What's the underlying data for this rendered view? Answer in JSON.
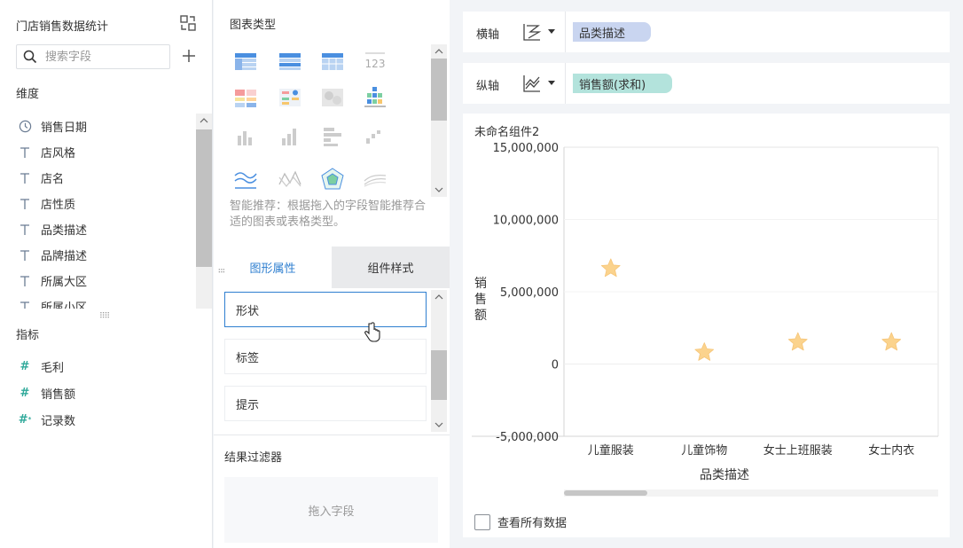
{
  "left_panel": {
    "dataset_title": "门店销售数据统计",
    "search_placeholder": "搜索字段",
    "dimension_label": "维度",
    "dimensions": [
      {
        "label": "销售日期",
        "icon": "clock-icon"
      },
      {
        "label": "店风格",
        "icon": "text-field-icon"
      },
      {
        "label": "店名",
        "icon": "text-field-icon"
      },
      {
        "label": "店性质",
        "icon": "text-field-icon"
      },
      {
        "label": "品类描述",
        "icon": "text-field-icon"
      },
      {
        "label": "品牌描述",
        "icon": "text-field-icon"
      },
      {
        "label": "所属大区",
        "icon": "text-field-icon"
      },
      {
        "label": "所属小区",
        "icon": "text-field-icon"
      }
    ],
    "measure_label": "指标",
    "measures": [
      {
        "label": "毛利",
        "icon": "hash-icon"
      },
      {
        "label": "销售额",
        "icon": "hash-icon"
      },
      {
        "label": "记录数",
        "icon": "hash-count-icon"
      }
    ]
  },
  "middle_panel": {
    "chart_type_title": "图表类型",
    "smart_tip": "智能推荐：根据拖入的字段智能推荐合适的图表或表格类型。",
    "tabs": [
      {
        "label": "图形属性",
        "active": true
      },
      {
        "label": "组件样式",
        "active": false
      }
    ],
    "properties": [
      "形状",
      "标签",
      "提示"
    ],
    "filter_title": "结果过滤器",
    "drop_placeholder": "拖入字段"
  },
  "axes": {
    "x_label": "横轴",
    "x_field": "品类描述",
    "x_field_color": "#c9d5f0",
    "y_label": "纵轴",
    "y_field": "销售额(求和)",
    "y_field_color": "#b3e3dc"
  },
  "chart_card": {
    "widget_name": "未命名组件2",
    "view_all_label": "查看所有数据"
  },
  "colors": {
    "accent": "#2f7fd0",
    "star": "#fbd38d"
  },
  "chart_data": {
    "type": "scatter",
    "marker": "star",
    "categories": [
      "儿童服装",
      "儿童饰物",
      "女士上班服装",
      "女士内衣"
    ],
    "values": [
      6600000,
      800000,
      1500000,
      1500000
    ],
    "xlabel": "品类描述",
    "ylabel": "销售额",
    "ylim": [
      -5000000,
      15000000
    ],
    "yticks": [
      -5000000,
      0,
      5000000,
      10000000,
      15000000
    ],
    "ytick_labels": [
      "-5,000,000",
      "0",
      "5,000,000",
      "10,000,000",
      "15,000,000"
    ],
    "grid": true
  }
}
